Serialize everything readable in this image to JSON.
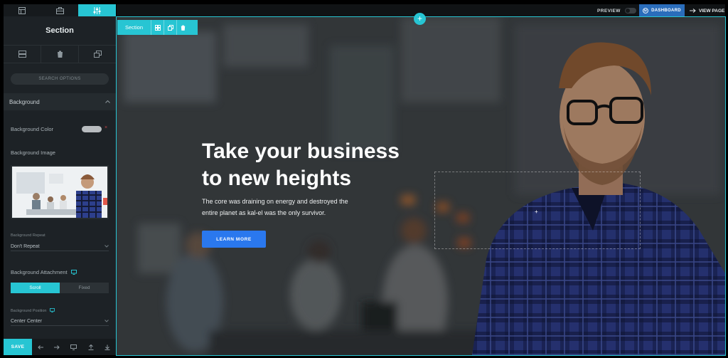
{
  "topbar": {
    "preview_label": "PREVIEW",
    "dashboard_label": "DASHBOARD",
    "view_page_label": "VIEW PAGE"
  },
  "sidebar": {
    "title": "Section",
    "search_placeholder": "SEARCH OPTIONS",
    "background_section": "Background",
    "background_color_label": "Background Color",
    "background_image_label": "Background Image",
    "background_repeat_label": "Background Repeat",
    "background_repeat_value": "Don't Repeat",
    "background_attachment_label": "Background Attachment",
    "attachment_options": [
      "Scroll",
      "Fixed"
    ],
    "attachment_selected": "Scroll",
    "background_position_label": "Background Position",
    "background_position_value": "Center Center",
    "save_label": "SAVE"
  },
  "canvas": {
    "section_toolbar_label": "Section",
    "headline_line1": "Take your business",
    "headline_line2": "to new heights",
    "body_line1": "The core was draining on energy and destroyed the",
    "body_line2": "entire planet as kal-el was the only survivor.",
    "cta_label": "LEARN MORE"
  },
  "colors": {
    "accent": "#27c5d3",
    "dashboard": "#2a6dbb",
    "cta": "#2a78ee",
    "sidebar_bg": "#1d2226"
  },
  "icons": [
    "layout-icon",
    "briefcase-icon",
    "sliders-icon",
    "rows-icon",
    "trash-icon",
    "duplicate-icon",
    "chevron-up-icon",
    "monitor-icon",
    "arrow-left-icon",
    "arrow-right-icon",
    "upload-icon",
    "download-icon",
    "wordpress-icon",
    "arrow-right-icon",
    "plus-icon"
  ]
}
